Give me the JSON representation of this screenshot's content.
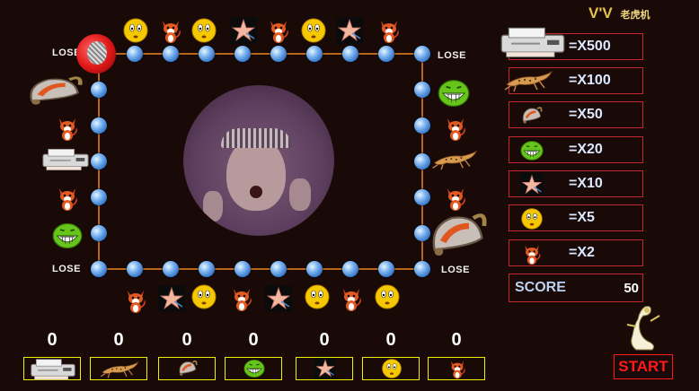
{
  "title": {
    "vv": "V'V",
    "name": "老虎机"
  },
  "lose_labels": [
    "LOSE",
    "LOSE",
    "LOSE",
    "LOSE"
  ],
  "paytable": [
    {
      "symbol": "printer-icon",
      "multiplier": "=X500"
    },
    {
      "symbol": "cheetah-icon",
      "multiplier": "=X100"
    },
    {
      "symbol": "bell-icon",
      "multiplier": "=X50"
    },
    {
      "symbol": "green-face-icon",
      "multiplier": "=X20"
    },
    {
      "symbol": "star-icon",
      "multiplier": "=X10"
    },
    {
      "symbol": "yellow-face-icon",
      "multiplier": "=X5"
    },
    {
      "symbol": "fox-icon",
      "multiplier": "=X2"
    }
  ],
  "score": {
    "label": "SCORE",
    "value": "50"
  },
  "bets": [
    {
      "symbol": "printer-icon",
      "count": "0"
    },
    {
      "symbol": "cheetah-icon",
      "count": "0"
    },
    {
      "symbol": "bell-icon",
      "count": "0"
    },
    {
      "symbol": "green-face-icon",
      "count": "0"
    },
    {
      "symbol": "star-icon",
      "count": "0"
    },
    {
      "symbol": "yellow-face-icon",
      "count": "0"
    },
    {
      "symbol": "fox-icon",
      "count": "0"
    }
  ],
  "start_label": "START",
  "colors": {
    "background": "#1a0a07",
    "border": "#c0282b",
    "bet_border": "#f0f000",
    "start": "#ff1a1a",
    "text_blue": "#dbe8ff"
  }
}
